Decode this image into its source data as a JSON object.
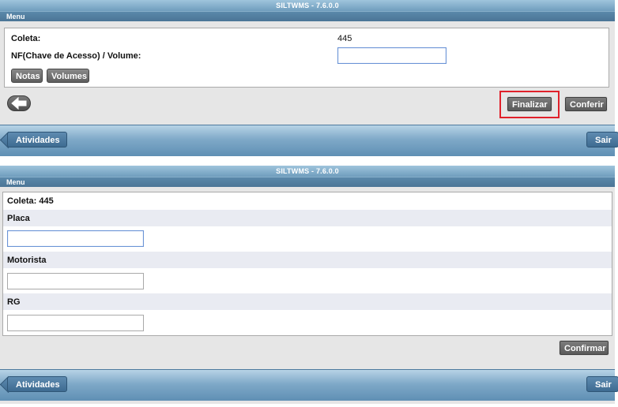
{
  "screen1": {
    "title": "SILTWMS - 7.6.0.0",
    "menu": "Menu",
    "coleta_label": "Coleta:",
    "coleta_value": "445",
    "nf_label": "NF(Chave de Acesso) / Volume:",
    "nf_value": "",
    "notas_button": "Notas",
    "volumes_button": "Volumes",
    "finalizar_button": "Finalizar",
    "conferir_button": "Conferir",
    "atividades_button": "Atividades",
    "sair_button": "Sair"
  },
  "screen2": {
    "title": "SILTWMS - 7.6.0.0",
    "menu": "Menu",
    "coleta_text": "Coleta: 445",
    "placa_label": "Placa",
    "placa_value": "",
    "motorista_label": "Motorista",
    "motorista_value": "",
    "rg_label": "RG",
    "rg_value": "",
    "confirmar_button": "Confirmar",
    "atividades_button": "Atividades",
    "sair_button": "Sair"
  },
  "colors": {
    "header_blue": "#6f9dbd",
    "menu_blue": "#4b7596",
    "highlight_red": "#e0202a",
    "button_gray": "#5e5e5e"
  },
  "icons": {
    "back": "left-arrow-icon"
  }
}
